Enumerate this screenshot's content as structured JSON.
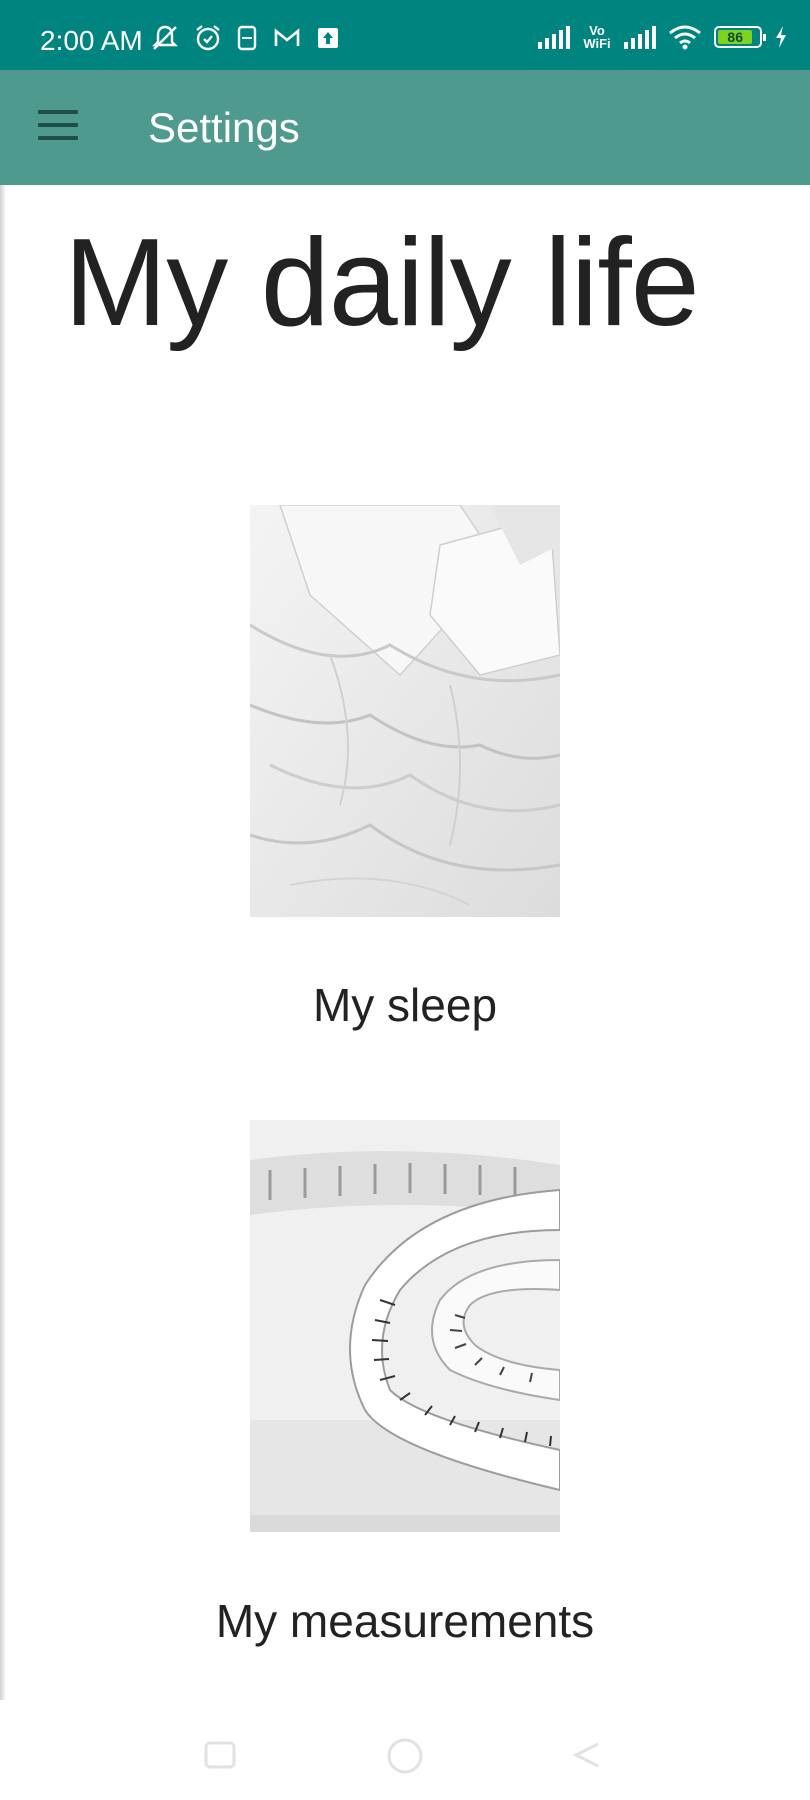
{
  "status_bar": {
    "time": "2:00 AM",
    "icons": [
      "notifications-muted-icon",
      "alarm-icon",
      "sim-icon",
      "gmail-icon",
      "upload-icon"
    ],
    "network_label": "Vo WiFi",
    "battery": "86"
  },
  "app_bar": {
    "title": "Settings"
  },
  "page": {
    "title": "My daily life"
  },
  "cards": [
    {
      "label": "My sleep",
      "image": "bed-sheets-photo"
    },
    {
      "label": "My measurements",
      "image": "tape-measure-photo"
    }
  ],
  "nav_bar": {
    "buttons": [
      "recent-apps-icon",
      "home-icon",
      "back-icon"
    ]
  },
  "colors": {
    "status_bar": "#008480",
    "app_bar": "#4e9a8f",
    "text": "#222222"
  }
}
